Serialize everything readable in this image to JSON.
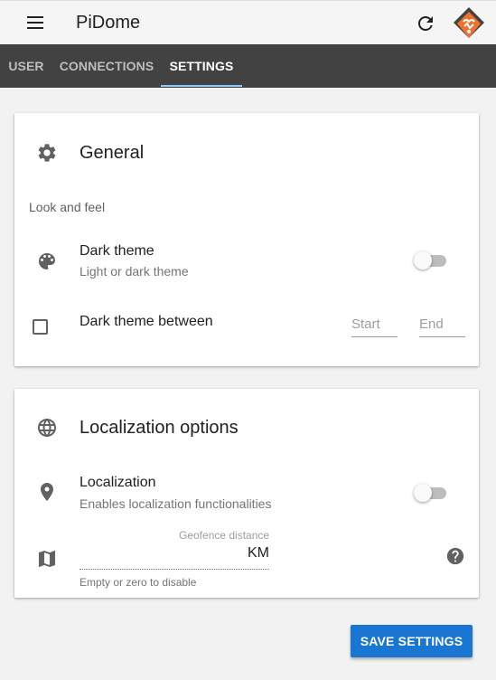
{
  "header": {
    "title": "PiDome",
    "menu_icon": "menu-icon",
    "refresh_icon": "refresh-icon",
    "logo_icon": "pidome-logo"
  },
  "tabs": [
    {
      "label": "USER",
      "active": false
    },
    {
      "label": "CONNECTIONS",
      "active": false
    },
    {
      "label": "SETTINGS",
      "active": true
    }
  ],
  "general": {
    "title": "General",
    "icon": "gear-icon",
    "subheader": "Look and feel",
    "dark_theme": {
      "title": "Dark theme",
      "subtitle": "Light or dark theme",
      "icon": "palette-icon",
      "enabled": false
    },
    "dark_between": {
      "label": "Dark theme between",
      "checked": false,
      "start_placeholder": "Start",
      "end_placeholder": "End"
    }
  },
  "localization": {
    "title": "Localization options",
    "icon": "globe-icon",
    "toggle": {
      "title": "Localization",
      "subtitle": "Enables localization functionalities",
      "icon": "location-pin-icon",
      "enabled": false
    },
    "geofence": {
      "label": "Geofence distance",
      "unit": "KM",
      "hint": "Empty or zero to disable",
      "icon": "map-icon",
      "help_icon": "help-icon"
    }
  },
  "actions": {
    "save_label": "SAVE SETTINGS"
  },
  "colors": {
    "tabbar": "#424242",
    "tab_indicator": "#90caf9",
    "primary_button": "#1976d2",
    "logo_orange": "#f07030",
    "logo_dark": "#424242"
  }
}
